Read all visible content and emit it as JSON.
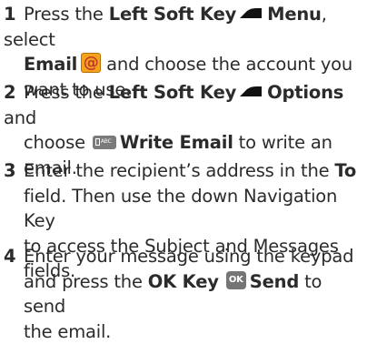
{
  "steps": [
    {
      "num": "1",
      "lines": [
        {
          "a": "Press the ",
          "b1": "Left Soft Key",
          "icon": "left-soft-key-icon",
          "b2": "Menu",
          "c": ", select"
        },
        {
          "b1": "Email",
          "icon": "email-icon",
          "icon_glyph": "@",
          "c": " and choose the account you"
        },
        {
          "a": "want to use."
        }
      ]
    },
    {
      "num": "2",
      "lines": [
        {
          "a": "Press the ",
          "b1": "Left Soft Key",
          "icon": "left-soft-key-icon",
          "b2": "Options",
          "c": " and"
        },
        {
          "a": "choose ",
          "icon": "write-email-icon",
          "icon_glyph": "ABC",
          "b2": "Write Email",
          "c": " to write an"
        },
        {
          "a": "email."
        }
      ]
    },
    {
      "num": "3",
      "lines": [
        {
          "a": "Enter the recipient’s address in the ",
          "b1": "To"
        },
        {
          "a": "field. Then use the down Navigation Key"
        },
        {
          "a": "to access the Subject and Messages"
        },
        {
          "a": "fields."
        }
      ]
    },
    {
      "num": "4",
      "lines": [
        {
          "a": "Enter your message using the keypad"
        },
        {
          "a": "and press the ",
          "b1": "OK Key",
          "icon": "ok-key-icon",
          "icon_glyph": "OK",
          "b2": "Send",
          "c": " to send"
        },
        {
          "a": "the email."
        }
      ]
    }
  ]
}
